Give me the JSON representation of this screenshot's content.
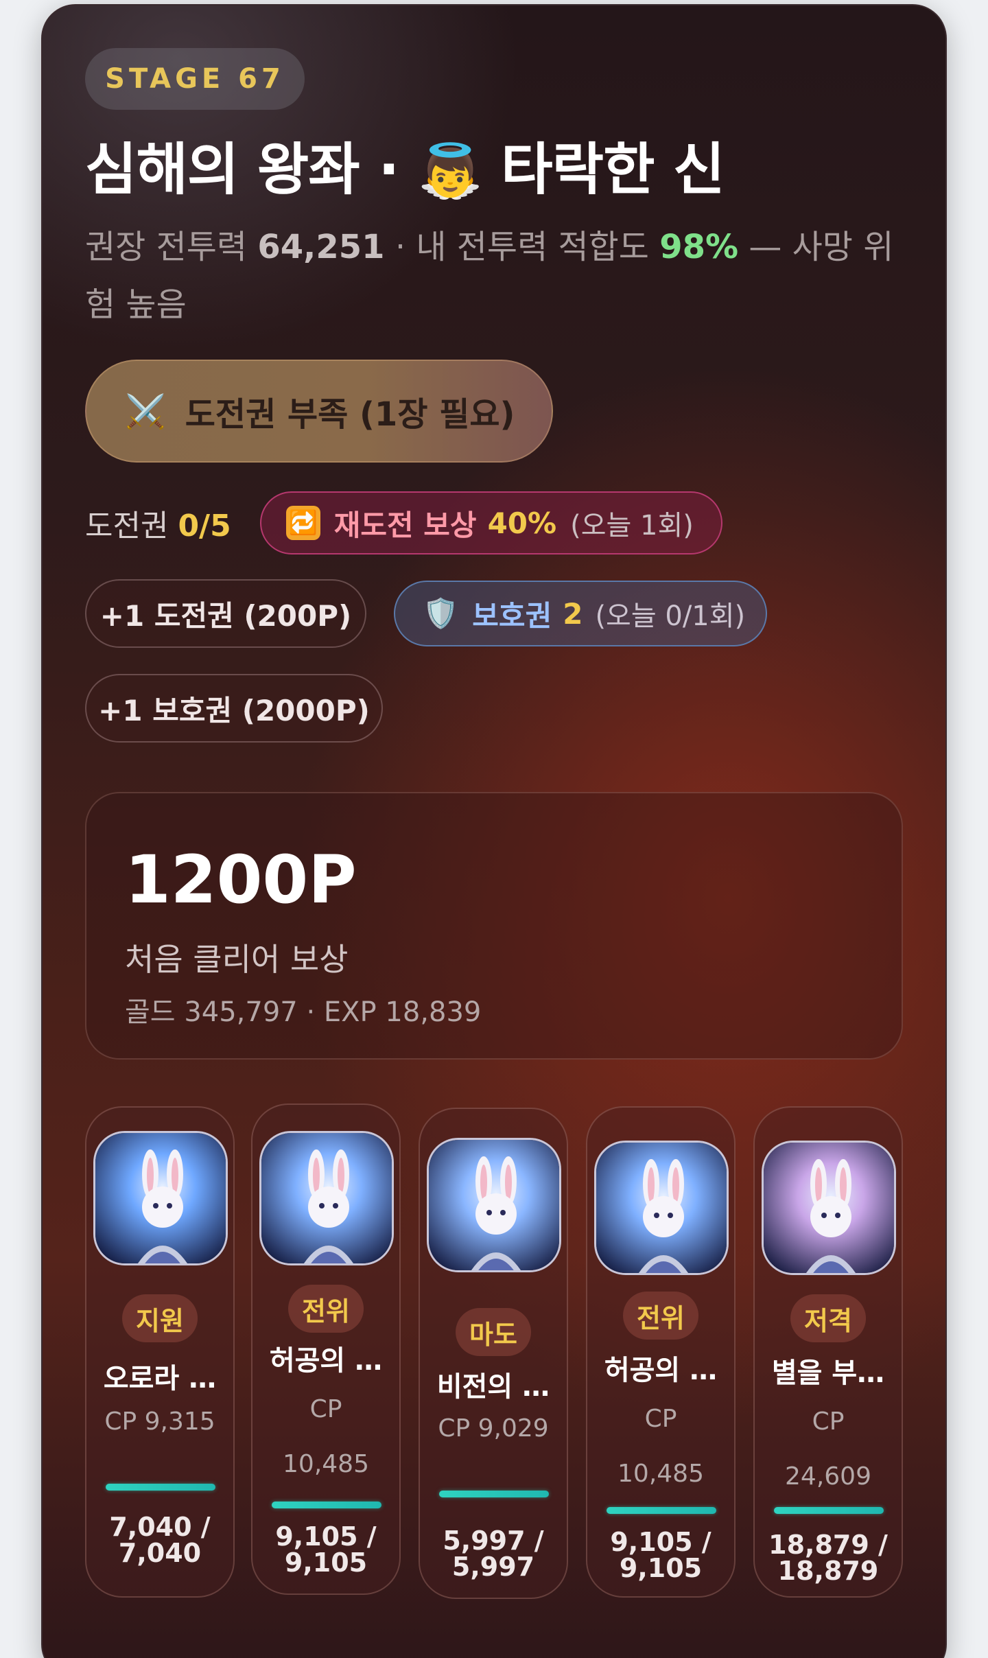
{
  "stage": {
    "label": "STAGE 67"
  },
  "title": {
    "prefix": "심해의 왕좌 · ",
    "emoji": "👼",
    "suffix": " 타락한 신"
  },
  "summary": {
    "rec_label": "권장 전투력 ",
    "rec_value": "64,251",
    "fit_label": " · 내 전투력 적합도 ",
    "fit_value": "98%",
    "risk": " — 사망 위험 높음"
  },
  "challenge_button": {
    "icon": "⚔️",
    "label": "도전권 부족 (1장 필요)"
  },
  "tickets": {
    "label": "도전권 ",
    "value": "0/5"
  },
  "retry": {
    "icon": "🔁",
    "label": "재도전 보상",
    "percent": "40%",
    "today": "(오늘 1회)"
  },
  "buy_ticket": {
    "label": "+1 도전권 (200P)"
  },
  "shield": {
    "icon": "🛡️",
    "label": "보호권",
    "count": "2",
    "today": "(오늘 0/1회)"
  },
  "buy_shield": {
    "label": "+1 보호권 (2000P)"
  },
  "reward": {
    "amount": "1200P",
    "label": "처음 클리어 보상",
    "sub": "골드 345,797 · EXP 18,839"
  },
  "heroes": [
    {
      "role": "지원",
      "name": "오로라 …",
      "cp": "CP 9,315",
      "hp": "7,040 /\n7,040",
      "hp_fraction": 1.0,
      "accent": "#6fa8ff"
    },
    {
      "role": "전위",
      "name": "허공의 …",
      "cp": "CP\n10,485",
      "hp": "9,105 /\n9,105",
      "hp_fraction": 1.0,
      "accent": "#7fb0ff"
    },
    {
      "role": "마도",
      "name": "비전의 …",
      "cp": "CP 9,029",
      "hp": "5,997 /\n5,997",
      "hp_fraction": 1.0,
      "accent": "#8ab6ff"
    },
    {
      "role": "전위",
      "name": "허공의 …",
      "cp": "CP\n10,485",
      "hp": "9,105 /\n9,105",
      "hp_fraction": 1.0,
      "accent": "#7fb0ff"
    },
    {
      "role": "저격",
      "name": "별을 부…",
      "cp": "CP\n24,609",
      "hp": "18,879 /\n18,879",
      "hp_fraction": 1.0,
      "accent": "#c9a6e8"
    }
  ]
}
